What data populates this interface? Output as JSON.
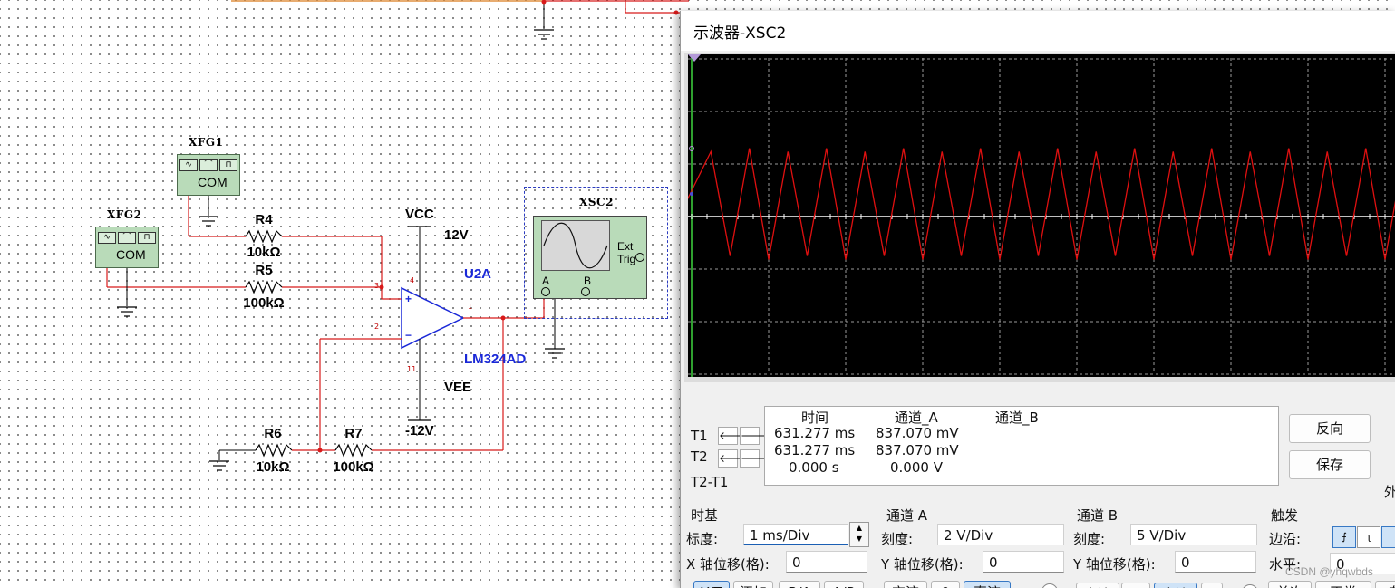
{
  "schematic": {
    "xfg1": {
      "name": "XFG1",
      "com": "COM"
    },
    "xfg2": {
      "name": "XFG2",
      "com": "COM"
    },
    "r4": {
      "name": "R4",
      "value": "10kΩ"
    },
    "r5": {
      "name": "R5",
      "value": "100kΩ"
    },
    "r6": {
      "name": "R6",
      "value": "10kΩ"
    },
    "r7": {
      "name": "R7",
      "value": "100kΩ"
    },
    "vcc": {
      "name": "VCC",
      "value": "12V"
    },
    "vee": {
      "name": "VEE",
      "value": "-12V"
    },
    "opamp": {
      "name": "U2A",
      "part": "LM324AD",
      "pin_plus": "3",
      "pin_minus": "2",
      "pin_out": "1",
      "pin_vcc": "4",
      "pin_vee": "11",
      "plus_sign": "+",
      "minus_sign": "−"
    },
    "xsc2": {
      "name": "XSC2",
      "ext_trig": "Ext Trig",
      "pin_a": "A",
      "pin_b": "B"
    },
    "wire_color": "#d81a1a"
  },
  "scope_window": {
    "title": "示波器-XSC2",
    "trace_color": "#e01010",
    "waveform": {
      "type": "triangle",
      "amplitude_divs": 1.3,
      "period_divs": 0.5
    },
    "cursor_table": {
      "row_labels": [
        "T1",
        "T2",
        "T2-T1"
      ],
      "headers": [
        "时间",
        "通道_A",
        "通道_B"
      ],
      "rows": [
        [
          "631.277 ms",
          "837.070 mV",
          ""
        ],
        [
          "631.277 ms",
          "837.070 mV",
          ""
        ],
        [
          "0.000 s",
          "0.000 V",
          ""
        ]
      ]
    },
    "buttons": {
      "reverse": "反向",
      "save": "保存",
      "ext": "外"
    },
    "timebase": {
      "section": "时基",
      "scale_label": "标度:",
      "scale_value": "1 ms/Div",
      "x_pos_label": "X 轴位移(格):",
      "x_pos_value": "0",
      "modes": [
        "Y/T",
        "添加",
        "B/A",
        "A/B"
      ]
    },
    "channel_a": {
      "section": "通道 A",
      "scale_label": "刻度:",
      "scale_value": "2  V/Div",
      "y_pos_label": "Y 轴位移(格):",
      "y_pos_value": "0",
      "coupling": [
        "交流",
        "0",
        "直流"
      ]
    },
    "channel_b": {
      "section": "通道 B",
      "scale_label": "刻度:",
      "scale_value": "5  V/Div",
      "y_pos_label": "Y 轴位移(格):",
      "y_pos_value": "0",
      "coupling": [
        "交流",
        "0",
        "直流",
        "-"
      ]
    },
    "trigger": {
      "section": "触发",
      "edge_label": "边沿:",
      "level_label": "水平:",
      "level_value": "0",
      "modes": [
        "单次",
        "正常",
        "自"
      ]
    }
  },
  "watermark": "CSDN @yhqwbds"
}
